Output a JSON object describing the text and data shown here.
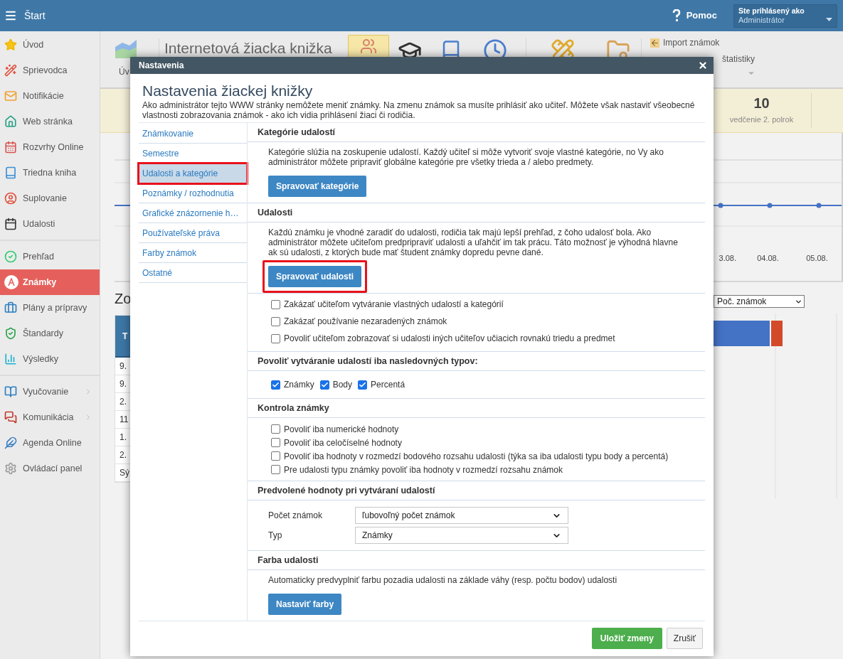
{
  "topbar": {
    "title": "Štart",
    "help": "Pomoc",
    "user_label": "Ste prihlásený ako",
    "user_name": "Administrátor"
  },
  "sidebar": {
    "groups": [
      [
        {
          "label": "Úvod",
          "selected": false,
          "submenu": false
        },
        {
          "label": "Sprievodca",
          "selected": false,
          "submenu": false
        },
        {
          "label": "Notifikácie",
          "selected": false,
          "submenu": false
        },
        {
          "label": "Web stránka",
          "selected": false,
          "submenu": false
        },
        {
          "label": "Rozvrhy Online",
          "selected": false,
          "submenu": false
        },
        {
          "label": "Triedna kniha",
          "selected": false,
          "submenu": false
        },
        {
          "label": "Suplovanie",
          "selected": false,
          "submenu": false
        },
        {
          "label": "Udalosti",
          "selected": false,
          "submenu": false
        }
      ],
      [
        {
          "label": "Prehľad",
          "selected": false,
          "submenu": false
        },
        {
          "label": "Známky",
          "selected": true,
          "submenu": false
        },
        {
          "label": "Plány a prípravy",
          "selected": false,
          "submenu": false
        },
        {
          "label": "Štandardy",
          "selected": false,
          "submenu": false
        },
        {
          "label": "Výsledky",
          "selected": false,
          "submenu": false
        }
      ],
      [
        {
          "label": "Vyučovanie",
          "selected": false,
          "submenu": true
        },
        {
          "label": "Komunikácia",
          "selected": false,
          "submenu": true
        },
        {
          "label": "Agenda Online",
          "selected": false,
          "submenu": false
        },
        {
          "label": "Ovládací panel",
          "selected": false,
          "submenu": false
        }
      ]
    ]
  },
  "background": {
    "toolbar": {
      "first_label": "Úv",
      "title": "Internetová žiacka knižka",
      "links": [
        "Import známok",
        "štatistiky"
      ]
    },
    "summary": {
      "value": "10",
      "label": "vedčenie 2. polrok"
    },
    "timeline": {
      "dates": [
        "3.08.",
        "04.08.",
        "05.08."
      ]
    },
    "section_title": "Zo",
    "select": {
      "value": "Poč. známok"
    },
    "table": {
      "header": "T",
      "rows": [
        "9.",
        "9.",
        "2.",
        "11",
        "1.",
        "2.",
        "Sý"
      ]
    }
  },
  "dialog": {
    "title": "Nastavenia",
    "heading": "Nastavenia žiackej knižky",
    "intro": "Ako administrátor tejto WWW stránky nemôžete meniť známky. Na zmenu známok sa musíte prihlásiť ako učiteľ. Môžete však nastaviť všeobecné vlastnosti zobrazovania známok - ako ich vidia prihlásení žiaci či rodičia.",
    "nav": [
      {
        "label": "Známkovanie",
        "selected": false
      },
      {
        "label": "Semestre",
        "selected": false
      },
      {
        "label": "Udalosti a kategórie",
        "selected": true
      },
      {
        "label": "Poznámky / rozhodnutia",
        "selected": false
      },
      {
        "label": "Grafické znázornenie h…",
        "selected": false
      },
      {
        "label": "Používateľské práva",
        "selected": false
      },
      {
        "label": "Farby známok",
        "selected": false
      },
      {
        "label": "Ostatné",
        "selected": false
      }
    ],
    "sections": [
      {
        "heading": "Kategórie udalostí",
        "dense": false,
        "items": [
          {
            "kind": "text",
            "text": "Kategórie slúžia na zoskupenie udalostí. Každý učiteľ si môže vytvoriť svoje vlastné kategórie, no Vy ako administrátor môžete pripraviť globálne kategórie pre všetky trieda a / alebo predmety."
          },
          {
            "kind": "button",
            "label": "Spravovať kategórie",
            "highlighted": false
          }
        ]
      },
      {
        "heading": "Udalosti",
        "dense": false,
        "items": [
          {
            "kind": "text",
            "text": "Každú známku je vhodné zaradiť do udalosti, rodičia tak majú lepší prehľad, z čoho udalosť bola. Ako administrátor môžete učiteľom predpripraviť udalosti a uľahčiť im tak prácu. Táto možnosť je výhodná hlavne ak sú udalosti, z ktorých bude mať študent známky dopredu pevne dané."
          },
          {
            "kind": "button",
            "label": "Spravovať udalosti",
            "highlighted": true
          }
        ]
      },
      {
        "dense": false,
        "items": [
          {
            "kind": "checkbox",
            "label": "Zakázať učiteľom vytváranie vlastných udalostí a kategórií",
            "checked": false
          },
          {
            "kind": "checkbox",
            "label": "Zakázať používanie nezaradených známok",
            "checked": false
          },
          {
            "kind": "checkbox",
            "label": "Povoliť učiteľom zobrazovať si udalosti iných učiteľov učiacich rovnakú triedu a predmet",
            "checked": false
          }
        ]
      },
      {
        "heading": "Povoliť vytváranie udalostí iba nasledovných typov:",
        "dense": false,
        "items": [
          {
            "kind": "checkbox_row",
            "options": [
              {
                "label": "Známky",
                "checked": true
              },
              {
                "label": "Body",
                "checked": true
              },
              {
                "label": "Percentá",
                "checked": true
              }
            ]
          }
        ]
      },
      {
        "heading": "Kontrola známky",
        "dense": true,
        "items": [
          {
            "kind": "checkbox",
            "label": "Povoliť iba numerické hodnoty",
            "checked": false
          },
          {
            "kind": "checkbox",
            "label": "Povoliť iba celočíselné hodnoty",
            "checked": false
          },
          {
            "kind": "checkbox",
            "label": "Povoliť iba hodnoty v rozmedzí bodového rozsahu udalosti (týka sa iba udalosti typu body a percentá)",
            "checked": false
          },
          {
            "kind": "checkbox",
            "label": "Pre udalosti typu známky povoliť iba hodnoty v rozmedzí rozsahu známok",
            "checked": false
          }
        ]
      },
      {
        "heading": "Predvolené hodnoty pri vytváraní udalostí",
        "dense": false,
        "items": [
          {
            "kind": "select",
            "label": "Počet známok",
            "value": "ľubovoľný počet známok"
          },
          {
            "kind": "select",
            "label": "Typ",
            "value": "Známky"
          }
        ]
      },
      {
        "heading": "Farba udalosti",
        "dense": false,
        "items": [
          {
            "kind": "text",
            "text": "Automaticky predvyplniť farbu pozadia udalosti na základe váhy (resp. počtu bodov) udalosti"
          },
          {
            "kind": "button",
            "label": "Nastaviť farby",
            "highlighted": false
          }
        ]
      }
    ],
    "footer": {
      "save": "Uložiť zmeny",
      "cancel": "Zrušiť"
    }
  }
}
